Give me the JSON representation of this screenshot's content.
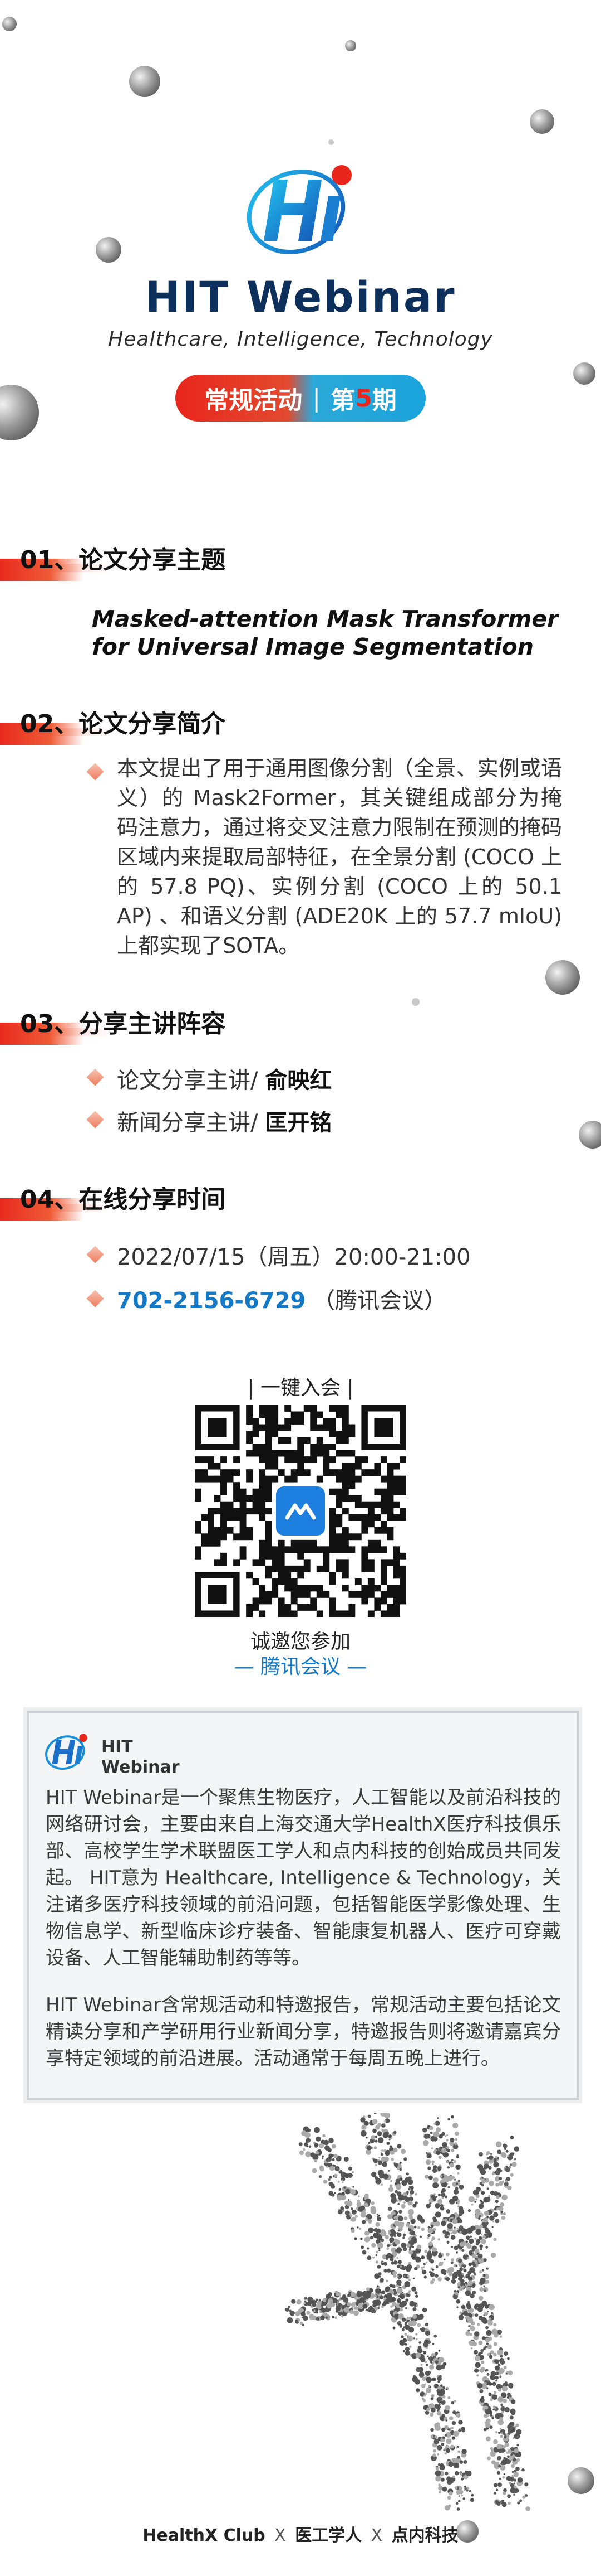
{
  "header": {
    "brand": "HIT Webinar",
    "tagline": "Healthcare, Intelligence, Technology",
    "event_type": "常规活动",
    "event_sep": "|",
    "event_prefix": "第",
    "event_num": "5",
    "event_suffix": "期"
  },
  "sections": {
    "s1": "01、论文分享主题",
    "s2": "02、论文分享简介",
    "s3": "03、分享主讲阵容",
    "s4": "04、在线分享时间"
  },
  "paper": {
    "title_line1": "Masked-attention Mask Transformer",
    "title_line2": "for Universal Image Segmentation"
  },
  "intro": {
    "text": "本文提出了用于通用图像分割（全景、实例或语义）的 Mask2Former，其关键组成部分为掩码注意力，通过将交叉注意力限制在预测的掩码区域内来提取局部特征，在全景分割 (COCO 上的 57.8 PQ)、实例分割 (COCO 上的 50.1 AP) 、和语义分割 (ADE20K 上的 57.7 mIoU) 上都实现了SOTA。"
  },
  "speakers": {
    "paper_label": "论文分享主讲/",
    "paper_name": "俞映红",
    "news_label": "新闻分享主讲/",
    "news_name": "匡开铭"
  },
  "schedule": {
    "datetime": "2022/07/15（周五）20:00-21:00",
    "meeting_id": "702-2156-6729",
    "platform": "（腾讯会议）"
  },
  "qr": {
    "caption": "| 一键入会 |",
    "invite": "诚邀您参加",
    "meeting": "— 腾讯会议 —"
  },
  "about": {
    "logo_line1": "HIT",
    "logo_line2": "Webinar",
    "para1": "HIT Webinar是一个聚焦生物医疗，人工智能以及前沿科技的网络研讨会，主要由来自上海交通大学HealthX医疗科技俱乐部、高校学生学术联盟医工学人和点内科技的创始成员共同发起。 HIT意为 Healthcare, Intelligence & Technology，关注诸多医疗科技领域的前沿问题，包括智能医学影像处理、生物信息学、新型临床诊疗装备、智能康复机器人、医疗可穿戴设备、人工智能辅助制药等等。",
    "para2": "HIT Webinar含常规活动和特邀报告，常规活动主要包括论文精读分享和产学研用行业新闻分享，特邀报告则将邀请嘉宾分享特定领域的前沿进展。活动通常于每周五晚上进行。"
  },
  "footer": {
    "org1": "HealthX Club",
    "sep": "X",
    "org2": "医工学人",
    "org3": "点内科技"
  },
  "colors": {
    "accent_red": "#e8261c",
    "accent_blue": "#1479c6",
    "brand_navy": "#0d2f5c"
  }
}
